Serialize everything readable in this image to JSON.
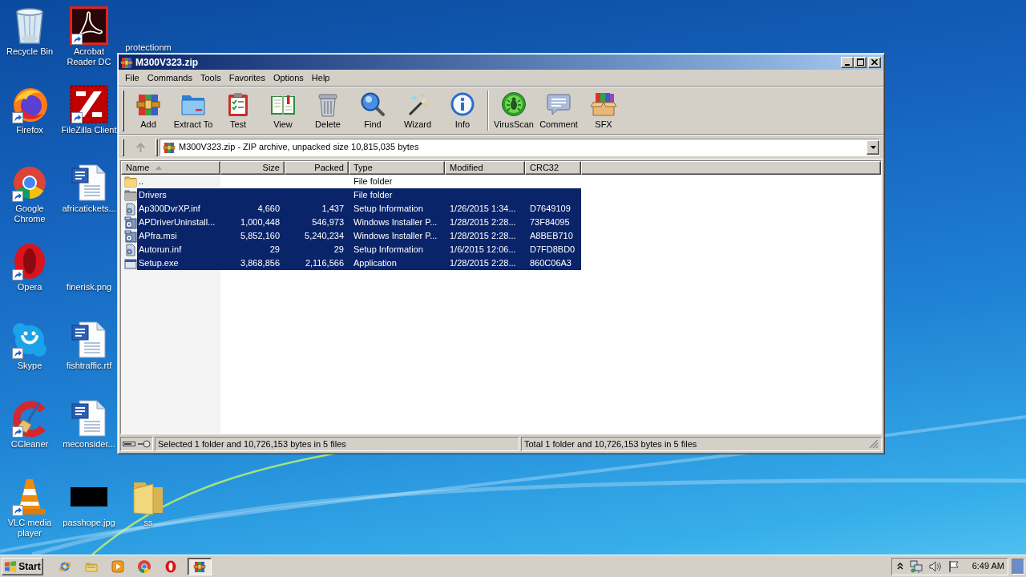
{
  "desktop": {
    "columns": [
      {
        "icons": [
          {
            "label": "Recycle Bin",
            "kind": "recycle-bin",
            "shortcut": false
          },
          {
            "label": "Firefox",
            "kind": "firefox",
            "shortcut": true
          },
          {
            "label": "Google Chrome",
            "kind": "chrome",
            "shortcut": true
          },
          {
            "label": "Opera",
            "kind": "opera",
            "shortcut": true
          },
          {
            "label": "Skype",
            "kind": "skype",
            "shortcut": true
          },
          {
            "label": "CCleaner",
            "kind": "ccleaner",
            "shortcut": true
          },
          {
            "label": "VLC media player",
            "kind": "vlc",
            "shortcut": true
          }
        ]
      },
      {
        "icons": [
          {
            "label": "Acrobat Reader DC",
            "kind": "acrobat",
            "shortcut": true
          },
          {
            "label": "FileZilla Client",
            "kind": "filezilla",
            "shortcut": true
          },
          {
            "label": "africatickets...",
            "kind": "word",
            "shortcut": false
          },
          {
            "label": "finerisk.png",
            "kind": "blank",
            "shortcut": false
          },
          {
            "label": "fishtraffic.rtf",
            "kind": "word",
            "shortcut": false
          },
          {
            "label": "meconsider...",
            "kind": "word",
            "shortcut": false
          },
          {
            "label": "passhope.jpg",
            "kind": "black-image",
            "shortcut": false
          }
        ]
      },
      {
        "icons": [
          {
            "label": "protectionm",
            "kind": "blank",
            "shortcut": false
          },
          {
            "label": "ss",
            "kind": "folder",
            "shortcut": false
          }
        ]
      }
    ]
  },
  "window": {
    "title": "M300V323.zip",
    "menu": [
      "File",
      "Commands",
      "Tools",
      "Favorites",
      "Options",
      "Help"
    ],
    "toolbar": [
      {
        "buttons": [
          {
            "label": "Add",
            "kind": "add"
          },
          {
            "label": "Extract To",
            "kind": "extract"
          },
          {
            "label": "Test",
            "kind": "test"
          },
          {
            "label": "View",
            "kind": "view"
          },
          {
            "label": "Delete",
            "kind": "delete"
          },
          {
            "label": "Find",
            "kind": "find"
          },
          {
            "label": "Wizard",
            "kind": "wizard"
          },
          {
            "label": "Info",
            "kind": "info"
          }
        ]
      },
      {
        "buttons": [
          {
            "label": "VirusScan",
            "kind": "virus-scan"
          },
          {
            "label": "Comment",
            "kind": "comment"
          },
          {
            "label": "SFX",
            "kind": "sfx"
          }
        ]
      }
    ],
    "up_button": {
      "disabled": true
    },
    "address": "M300V323.zip - ZIP archive, unpacked size 10,815,035 bytes",
    "columns": [
      {
        "label": "Name",
        "sorted": true
      },
      {
        "label": "Size",
        "sorted": false
      },
      {
        "label": "Packed",
        "sorted": false
      },
      {
        "label": "Type",
        "sorted": false
      },
      {
        "label": "Modified",
        "sorted": false
      },
      {
        "label": "CRC32",
        "sorted": false
      }
    ],
    "rows": [
      {
        "kind": "parent",
        "name": "..",
        "type": "File folder",
        "selected": false
      },
      {
        "kind": "folder",
        "name": "Drivers",
        "type": "File folder",
        "selected": true
      },
      {
        "kind": "setup-info",
        "name": "Ap300DvrXP.inf",
        "size": "4,660",
        "packed": "1,437",
        "type": "Setup Information",
        "modified": "1/26/2015 1:34...",
        "crc32": "D7649109",
        "selected": true
      },
      {
        "kind": "installer",
        "name": "APDriverUninstall...",
        "size": "1,000,448",
        "packed": "546,973",
        "type": "Windows Installer P...",
        "modified": "1/28/2015 2:28...",
        "crc32": "73F84095",
        "selected": true
      },
      {
        "kind": "installer",
        "name": "APfra.msi",
        "size": "5,852,160",
        "packed": "5,240,234",
        "type": "Windows Installer P...",
        "modified": "1/28/2015 2:28...",
        "crc32": "A8BEB710",
        "selected": true
      },
      {
        "kind": "setup-info",
        "name": "Autorun.inf",
        "size": "29",
        "packed": "29",
        "type": "Setup Information",
        "modified": "1/6/2015 12:06...",
        "crc32": "D7FD8BD0",
        "selected": true
      },
      {
        "kind": "application",
        "name": "Setup.exe",
        "size": "3,868,856",
        "packed": "2,116,566",
        "type": "Application",
        "modified": "1/28/2015 2:28...",
        "crc32": "860C06A3",
        "selected": true
      }
    ],
    "status": {
      "left": "Selected 1 folder and 10,726,153 bytes in 5 files",
      "right": "Total 1 folder and 10,726,153 bytes in 5 files"
    }
  },
  "taskbar": {
    "start": "Start",
    "apps": [
      {
        "kind": "ie",
        "active": false
      },
      {
        "kind": "explorer",
        "active": false
      },
      {
        "kind": "media-player",
        "active": false
      },
      {
        "kind": "chrome",
        "active": false
      },
      {
        "kind": "opera",
        "active": false
      },
      {
        "kind": "winrar",
        "active": true
      }
    ],
    "clock": "6:49 AM"
  }
}
